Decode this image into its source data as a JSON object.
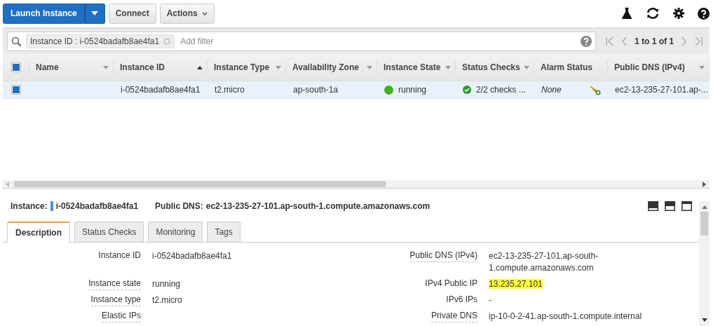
{
  "toolbar": {
    "launch_button": "Launch Instance",
    "connect_button": "Connect",
    "actions_button": "Actions"
  },
  "filter": {
    "chip": "Instance ID : i-0524badafb8ae4fa1",
    "placeholder": "Add filter",
    "pagination": "1 to 1 of 1"
  },
  "table": {
    "select_all_checked": true,
    "columns": [
      {
        "label": "Name",
        "kind": "menu"
      },
      {
        "label": "Instance ID",
        "kind": "sorted"
      },
      {
        "label": "Instance Type",
        "kind": "menu"
      },
      {
        "label": "Availability Zone",
        "kind": "menu"
      },
      {
        "label": "Instance State",
        "kind": "menu"
      },
      {
        "label": "Status Checks",
        "kind": "menu"
      },
      {
        "label": "Alarm Status",
        "kind": "plain"
      },
      {
        "label": "Public DNS (IPv4)",
        "kind": "menu"
      }
    ],
    "rows": [
      {
        "selected": true,
        "instance_id": "i-0524badafb8ae4fa1",
        "instance_type": "t2.micro",
        "zone": "ap-south-1a",
        "state": "running",
        "state_ok": true,
        "checks": "2/2 checks ...",
        "checks_ok": true,
        "alarm": "None",
        "dns": "ec2-13-235-27-101.ap-..."
      }
    ]
  },
  "details": {
    "instance_label": "Instance:",
    "instance_id": "i-0524badafb8ae4fa1",
    "dns_label": "Public DNS:",
    "dns_value": "ec2-13-235-27-101.ap-south-1.compute.amazonaws.com",
    "tabs": [
      {
        "label": "Description",
        "selected": true
      },
      {
        "label": "Status Checks",
        "selected": false
      },
      {
        "label": "Monitoring",
        "selected": false
      },
      {
        "label": "Tags",
        "selected": false
      }
    ],
    "left_fields": [
      {
        "label": "Instance ID",
        "value": "i-0524badafb8ae4fa1",
        "underlined": false
      },
      {
        "label": "Instance state",
        "value": "running",
        "underlined": true
      },
      {
        "label": "Instance type",
        "value": "t2.micro",
        "underlined": true
      },
      {
        "label": "Elastic IPs",
        "underlined": true
      }
    ],
    "right_fields": [
      {
        "label": "Public DNS (IPv4)",
        "value": "ec2-13-235-27-101.ap-south-1.compute.amazonaws.com",
        "underlined": true,
        "highlighted": false
      },
      {
        "label": "IPv4 Public IP",
        "value": "13.235.27.101",
        "underlined": false,
        "highlighted": true
      },
      {
        "label": "IPv6 IPs",
        "value": "-",
        "underlined": false,
        "highlighted": false
      },
      {
        "label": "Private DNS",
        "value": "ip-10-0-2-41.ap-south-1.compute.internal",
        "underlined": true,
        "highlighted": false
      }
    ]
  }
}
